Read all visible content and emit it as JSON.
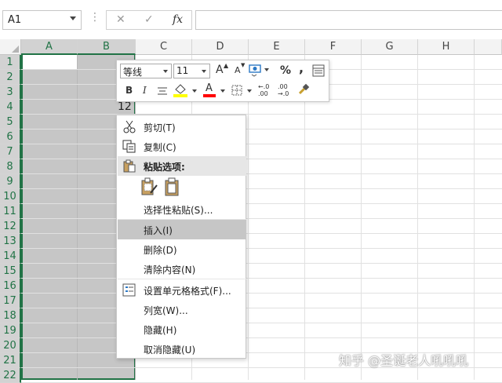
{
  "formula_bar": {
    "name_box": "A1",
    "dots": "⋮",
    "cancel_icon": "✕",
    "enter_icon": "✓",
    "fx_label": "fx"
  },
  "columns": [
    "A",
    "B",
    "C",
    "D",
    "E",
    "F",
    "G",
    "H"
  ],
  "selected_columns": [
    "A",
    "B"
  ],
  "rows": [
    "1",
    "2",
    "3",
    "4",
    "5",
    "6",
    "7",
    "8",
    "9",
    "10",
    "11",
    "12",
    "13",
    "14",
    "15",
    "16",
    "17",
    "18",
    "19",
    "20",
    "21",
    "22"
  ],
  "cells": {
    "B4": "12"
  },
  "mini_toolbar": {
    "font_name": "等线",
    "font_size": "11",
    "grow_font": "A",
    "shrink_font": "A",
    "percent": "%",
    "comma": ",",
    "bold": "B",
    "italic": "I",
    "font_color_letter": "A",
    "decrease_decimal": "←.0\n.00",
    "increase_decimal": ".00\n→.0",
    "fill_color": "#ffff00",
    "font_color": "#ff0000"
  },
  "context_menu": {
    "cut": "剪切(T)",
    "copy": "复制(C)",
    "paste_options": "粘贴选项:",
    "paste_special": "选择性粘贴(S)...",
    "insert": "插入(I)",
    "delete": "删除(D)",
    "clear_contents": "清除内容(N)",
    "format_cells": "设置单元格格式(F)...",
    "column_width": "列宽(W)...",
    "hide": "隐藏(H)",
    "unhide": "取消隐藏(U)"
  },
  "watermark": "知乎 @圣诞老人吼吼吼",
  "colors": {
    "accent_green": "#217346",
    "selection_gray": "#c6c6c6"
  }
}
